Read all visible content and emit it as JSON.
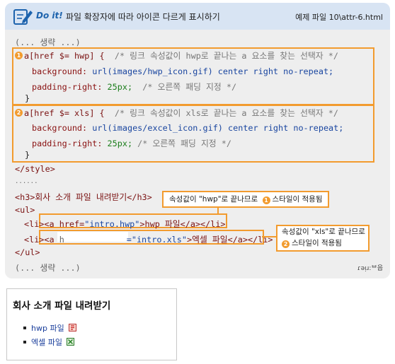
{
  "header": {
    "doit_label": "Do it!",
    "title": "파일 확장자에 따라 아이콘 다르게 표시하기",
    "file": "예제 파일 10\\attr-6.html"
  },
  "code": {
    "ellipsis_top": "(... 생략 ...)",
    "b1_selector": "a[href $= hwp] {",
    "b1_comment": "/* 링크 속성값이 hwp로 끝나는 a 요소를 찾는 선택자 */",
    "b1_bg_prop": "background:",
    "b1_bg_val": "url(images/hwp_icon.gif) center right no-repeat;",
    "b1_pad_prop": "padding-right:",
    "b1_pad_val": "25px;",
    "b1_pad_comment": "/* 오른쪽 패딩 지정 */",
    "close": "}",
    "b2_selector": "a[href $= xls] {",
    "b2_comment": "/* 링크 속성값이 xls로 끝나는 a 요소를 찾는 선택자 */",
    "b2_bg_prop": "background:",
    "b2_bg_val": "url(images/excel_icon.gif) center right no-repeat;",
    "b2_pad_prop": "padding-right:",
    "b2_pad_val": "25px;",
    "b2_pad_comment": "/* 오른쪽 패딩 지정 */",
    "style_close": "</style>",
    "dots": "......",
    "h3_line": "<h3>회사 소개 파일 내려받기</h3>",
    "ul_open": "<ul>",
    "li1_open": "<li>",
    "li1_a": "<a href=",
    "li1_href": "\"intro.hwp\"",
    "li1_rest": ">hwp 파일</a></li>",
    "li2_open": "<li>",
    "li2_a": "<a",
    "li2_h": "h",
    "li2_href": "=\"intro.xls\"",
    "li2_rest": ">엑셀 파일</a></li>",
    "ul_close": "</ul>",
    "ellipsis_bottom": "(... 생략 ...)",
    "footer_mark": "ɾǝᴉɹ:ᄇ읍"
  },
  "markers": [
    "1",
    "2"
  ],
  "callouts": {
    "hwp_pre": "속성값이 \"hwp\"로 끝나므로",
    "hwp_post": "스타일이 적용됨",
    "xls_line1": "속성값이 \"xls\"로 끝나므로",
    "xls_line2": "스타일이 적용됨"
  },
  "result": {
    "title": "회사 소개 파일 내려받기",
    "items": [
      "hwp 파일",
      "엑셀 파일"
    ]
  },
  "colors": {
    "accent": "#f29b2e",
    "header_bg": "#d8e4f3",
    "panel_bg": "#eeeeee",
    "link": "#1a3e9b"
  }
}
